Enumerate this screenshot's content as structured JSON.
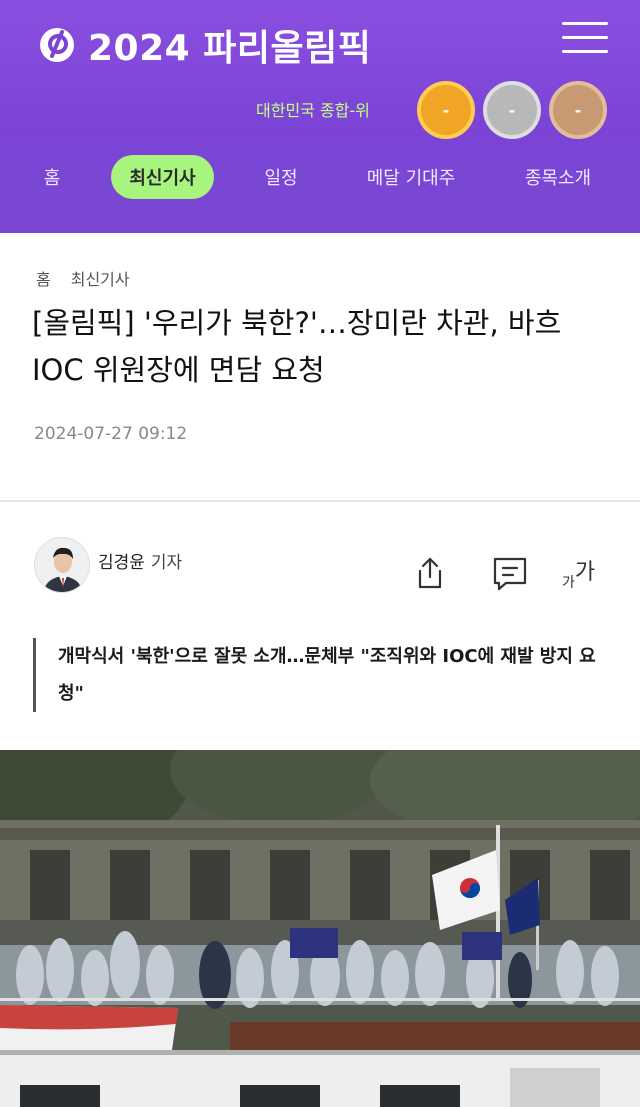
{
  "header": {
    "title": "2024 파리올림픽",
    "medal_label": "대한민국 종합-위",
    "medals": {
      "gold": "-",
      "silver": "-",
      "bronze": "-"
    }
  },
  "nav": {
    "items": [
      {
        "label": "홈"
      },
      {
        "label": "최신기사"
      },
      {
        "label": "일정"
      },
      {
        "label": "메달 기대주"
      },
      {
        "label": "종목소개"
      }
    ],
    "active": "최신기사"
  },
  "article": {
    "breadcrumb": [
      "홈",
      "최신기사"
    ],
    "headline": "[올림픽] '우리가 북한?'…장미란 차관, 바흐 IOC 위원장에 면담 요청",
    "date": "2024-07-27 09:12",
    "author": {
      "name": "김경윤",
      "role": "기자"
    },
    "font_tool_label": "가가",
    "subheading": "개막식서 '북한'으로 잘못 소개…문체부 \"조직위와 IOC에 재발 방지 요청\""
  },
  "colors": {
    "header_purple": "#7b44d6",
    "active_tab": "#a7f57e",
    "medal_label": "#c6ff82"
  }
}
